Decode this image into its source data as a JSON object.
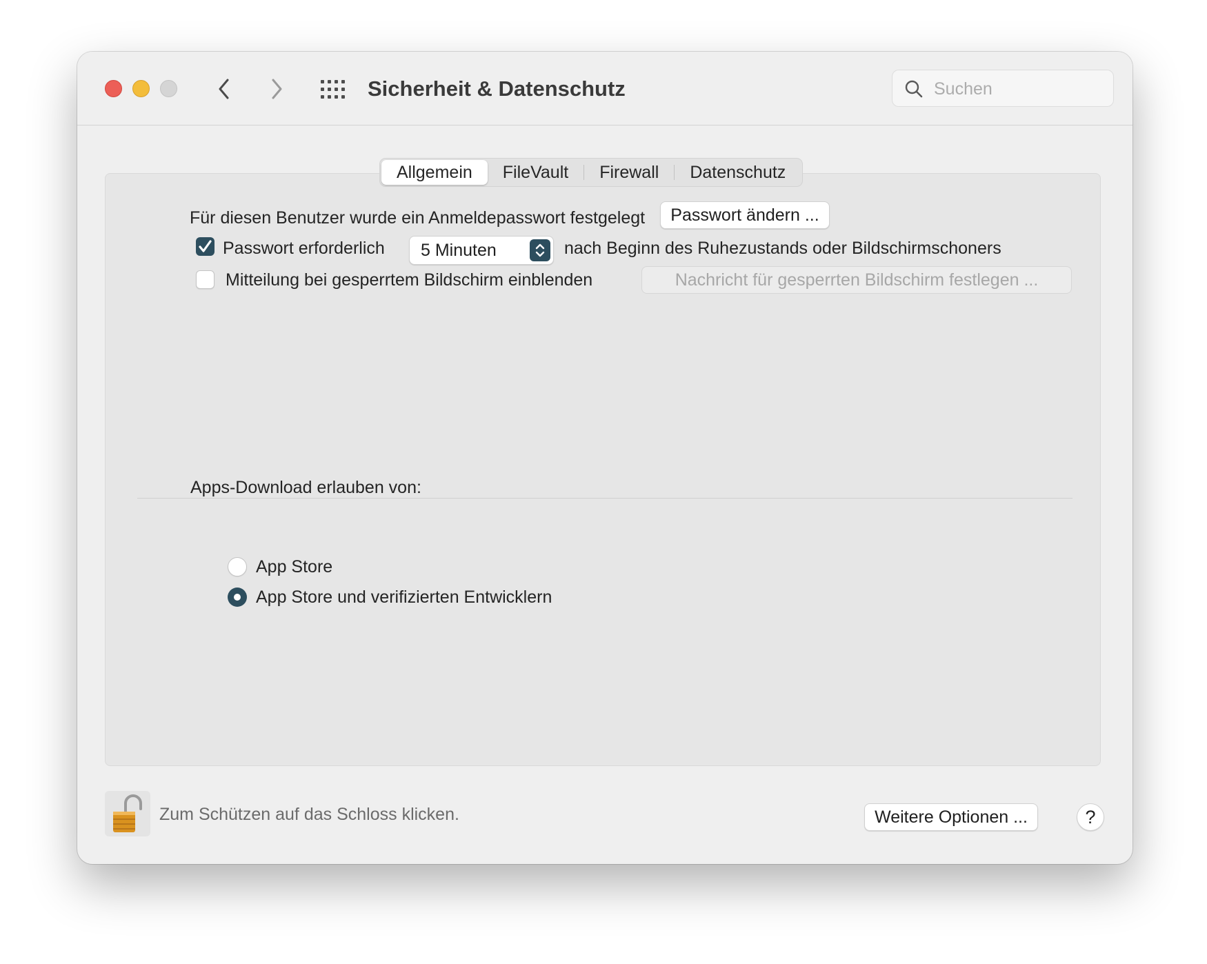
{
  "window": {
    "title": "Sicherheit & Datenschutz"
  },
  "search": {
    "placeholder": "Suchen",
    "value": ""
  },
  "tabs": [
    {
      "label": "Allgemein",
      "active": true
    },
    {
      "label": "FileVault",
      "active": false
    },
    {
      "label": "Firewall",
      "active": false
    },
    {
      "label": "Datenschutz",
      "active": false
    }
  ],
  "general": {
    "password_set_text": "Für diesen Benutzer wurde ein Anmeldepasswort festgelegt",
    "change_password_button": "Passwort ändern ...",
    "require_password": {
      "checked": true,
      "label": "Passwort erforderlich",
      "delay_value": "5 Minuten",
      "suffix": "nach Beginn des Ruhezustands oder Bildschirmschoners"
    },
    "lock_message": {
      "checked": false,
      "label": "Mitteilung bei gesperrtem Bildschirm einblenden",
      "button": "Nachricht für gesperrten Bildschirm festlegen ..."
    }
  },
  "downloads": {
    "heading": "Apps-Download erlauben von:",
    "options": [
      {
        "label": "App Store",
        "selected": false
      },
      {
        "label": "App Store und verifizierten Entwicklern",
        "selected": true
      }
    ]
  },
  "footer": {
    "lock_text": "Zum Schützen auf das Schloss klicken.",
    "more_options_button": "Weitere Optionen ...",
    "help_label": "?"
  },
  "colors": {
    "accent": "#2d4e5e",
    "close": "#ec5f57",
    "minimize": "#f3bd3b",
    "zoom_disabled": "#d5d5d5"
  },
  "icons": {
    "back": "chevron-left-icon",
    "forward": "chevron-right-icon",
    "grid": "grid-icon",
    "search": "search-icon",
    "lock": "lock-open-icon",
    "checkmark": "checkmark-icon",
    "stepper": "up-down-chevron-icon"
  }
}
